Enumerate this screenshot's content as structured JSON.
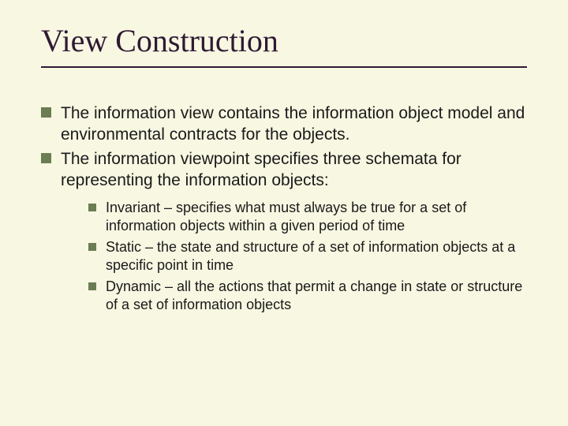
{
  "slide": {
    "title": "View Construction",
    "bullets": [
      {
        "text": "The information view contains the information object model and environmental contracts for the objects."
      },
      {
        "text": "The information viewpoint specifies three schemata for representing the information objects:",
        "children": [
          {
            "text": "Invariant – specifies what must always be true for a set of information objects within a given period of time"
          },
          {
            "text": "Static – the state and structure of a set of information objects at a specific point in time"
          },
          {
            "text": "Dynamic – all the actions that permit a change in state or structure of a set of information objects"
          }
        ]
      }
    ]
  },
  "colors": {
    "background": "#f8f7e2",
    "title": "#2f1a33",
    "bullet": "#6b7d52"
  }
}
